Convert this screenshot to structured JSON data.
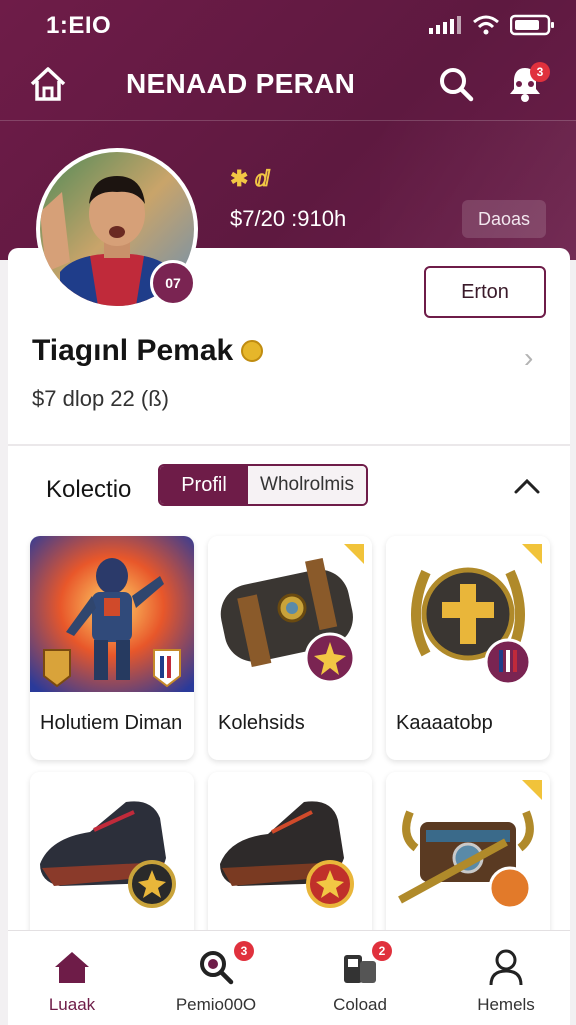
{
  "status_bar": {
    "time": "1:ΕΙΟ"
  },
  "nav": {
    "title": "NENAAD PERAN",
    "notification_count": "3"
  },
  "profile": {
    "level": "07",
    "rating": "✱ ⅆ",
    "price": "$7/20 :910h",
    "dark_button": "Daoas",
    "outline_button": "Erton",
    "name": "Tiagınl Pemak",
    "subline": "$7 dlop 22 (ß)"
  },
  "collection": {
    "title": "Kolectio",
    "tabs": [
      "Profil",
      "Wholrolmis"
    ],
    "items": [
      {
        "label": "Holutiem Diman",
        "art": "armored-hero-card"
      },
      {
        "label": "Kolehsids",
        "art": "scroll-badge"
      },
      {
        "label": "Kaaaatobp",
        "art": "laurel-emblem"
      },
      {
        "label": "",
        "art": "boots-blue"
      },
      {
        "label": "",
        "art": "boots-red"
      },
      {
        "label": "",
        "art": "gauntlet"
      }
    ]
  },
  "tabbar": {
    "items": [
      {
        "label": "Luaak",
        "icon": "home-icon"
      },
      {
        "label": "Pemio00O",
        "icon": "search-icon",
        "badge": "3"
      },
      {
        "label": "Coload",
        "icon": "cards-icon",
        "badge": "2"
      },
      {
        "label": "Hemels",
        "icon": "person-icon"
      }
    ]
  },
  "colors": {
    "brand": "#6e1c48",
    "accent": "#f2c744",
    "badge": "#e0313d"
  }
}
